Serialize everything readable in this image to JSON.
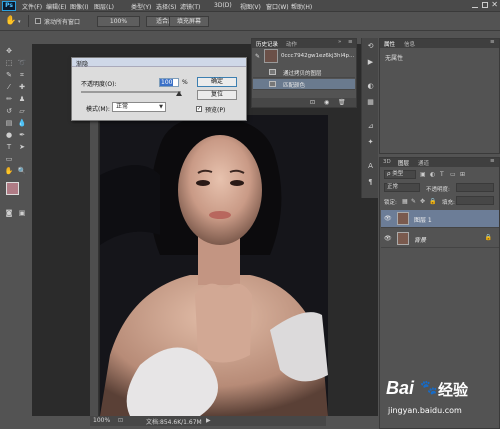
{
  "app": {
    "logo": "Ps"
  },
  "menu": [
    {
      "label": "文件(F)"
    },
    {
      "label": "编辑(E)"
    },
    {
      "label": "图像(I)"
    },
    {
      "label": "图层(L)"
    },
    {
      "label": "类型(Y)"
    },
    {
      "label": "选择(S)"
    },
    {
      "label": "滤镜(T)"
    },
    {
      "label": "3D(D)"
    },
    {
      "label": "视图(V)"
    },
    {
      "label": "窗口(W)"
    },
    {
      "label": "帮助(H)"
    }
  ],
  "options_bar": {
    "scroll_all_label": "滚动所有窗口",
    "zoom_100": "100%",
    "fit_screen": "适合屏幕",
    "fill_screen": "填充屏幕"
  },
  "dialog": {
    "title": "渐隐",
    "opacity_label": "不透明度(O):",
    "opacity_value": "100",
    "percent": "%",
    "mode_label": "模式(M):",
    "mode_value": "正常",
    "ok": "确定",
    "reset": "复位",
    "preview_label": "预览(P)",
    "preview_checked": true
  },
  "history": {
    "tabs": [
      {
        "label": "历史记录"
      },
      {
        "label": "动作"
      }
    ],
    "snapshot_label": "0ccc7942gw1ez6kj3hl4p...",
    "items": [
      {
        "label": "通过拷贝的图层"
      },
      {
        "label": "匹配颜色"
      }
    ]
  },
  "properties": {
    "tabs": [
      {
        "label": "属性"
      },
      {
        "label": "信息"
      }
    ],
    "empty_text": "无属性"
  },
  "layers": {
    "tabs": [
      {
        "label": "3D"
      },
      {
        "label": "图层"
      },
      {
        "label": "通道"
      }
    ],
    "kind_filter": "ρ 类型",
    "blend_mode": "正常",
    "opacity_label": "不透明度:",
    "lock_label": "锁定:",
    "fill_label": "填充:",
    "items": [
      {
        "name": "图层 1",
        "selected": true
      },
      {
        "name": "背景",
        "selected": false,
        "locked": true
      }
    ]
  },
  "status": {
    "zoom": "100%",
    "doc_info": "文档:854.6K/1.67M"
  },
  "watermark": {
    "brand": "Bai",
    "brand_suffix": "经验",
    "url": "jingyan.baidu.com"
  }
}
